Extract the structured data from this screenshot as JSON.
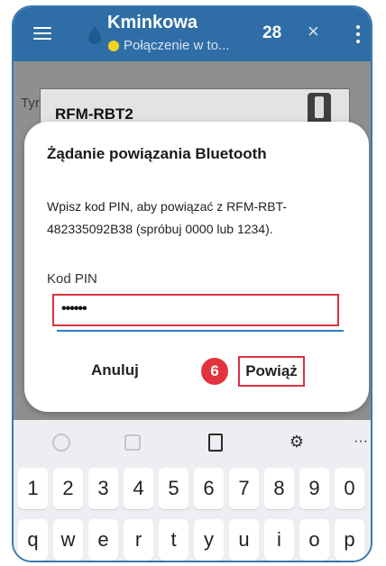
{
  "appbar": {
    "title": "Kminkowa",
    "subtitle": "Połączenie w to...",
    "count": "28",
    "close_glyph": "×",
    "status_color": "#f2d21f",
    "bar_color": "#2f6da6",
    "icons": [
      "menu-icon",
      "drop-icon",
      "close-icon",
      "more-vert-icon"
    ]
  },
  "background": {
    "typ_label": "Tyr",
    "device_card": "RFM-RBT2"
  },
  "dialog": {
    "title": "Żądanie powiązania Bluetooth",
    "message": "Wpisz kod PIN, aby powiązać z RFM-RBT-482335092B38 (spróbuj 0000 lub 1234).",
    "pin_label": "Kod PIN",
    "pin_value": "••••••",
    "cancel_label": "Anuluj",
    "confirm_label": "Powiąż",
    "step_badge": "6",
    "highlight_color": "#d93240"
  },
  "keyboard": {
    "toolbar_icons": [
      "emoji-icon",
      "sticker-icon",
      "clipboard-icon",
      "settings-icon",
      "more-horiz-icon"
    ],
    "settings_glyph": "⚙",
    "more_glyph": "···",
    "number_row": [
      "1",
      "2",
      "3",
      "4",
      "5",
      "6",
      "7",
      "8",
      "9",
      "0"
    ],
    "letter_row": [
      "q",
      "w",
      "e",
      "r",
      "t",
      "y",
      "u",
      "i",
      "o",
      "p"
    ]
  }
}
